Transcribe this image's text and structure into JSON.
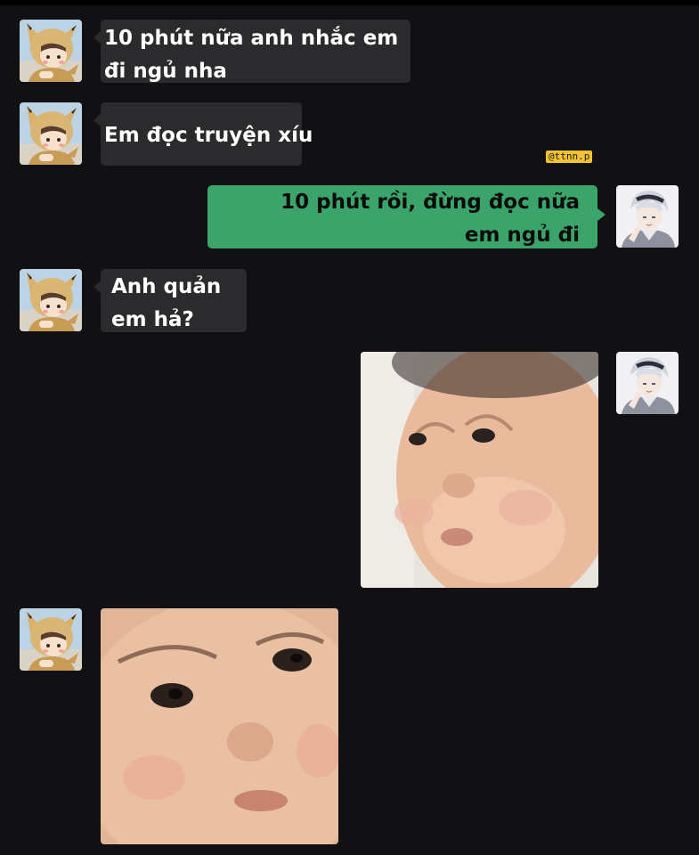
{
  "watermark": "@ttnn.p",
  "messages": [
    {
      "from": "left",
      "lines": [
        "10 phút nữa anh nhắc em",
        "đi ngủ nha"
      ]
    },
    {
      "from": "left",
      "lines": [
        "Em đọc truyện xíu"
      ]
    },
    {
      "from": "right",
      "lines": [
        "10 phút rồi, đừng đọc nữa",
        "em ngủ đi"
      ]
    },
    {
      "from": "left",
      "lines": [
        "Anh quản",
        "em hả?"
      ]
    },
    {
      "from": "right",
      "type": "image",
      "subject": "pouting-baby-photo"
    },
    {
      "from": "left",
      "type": "image",
      "subject": "baby-closeup-photo"
    }
  ],
  "avatars": {
    "left": {
      "icon": "pikachu-costume-avatar-icon"
    },
    "right": {
      "icon": "white-haired-boy-avatar-icon"
    }
  },
  "colors": {
    "background": "#111012",
    "left_bubble": "#2b2b2d",
    "right_bubble": "#3aa46b",
    "watermark": "#f2c230"
  }
}
